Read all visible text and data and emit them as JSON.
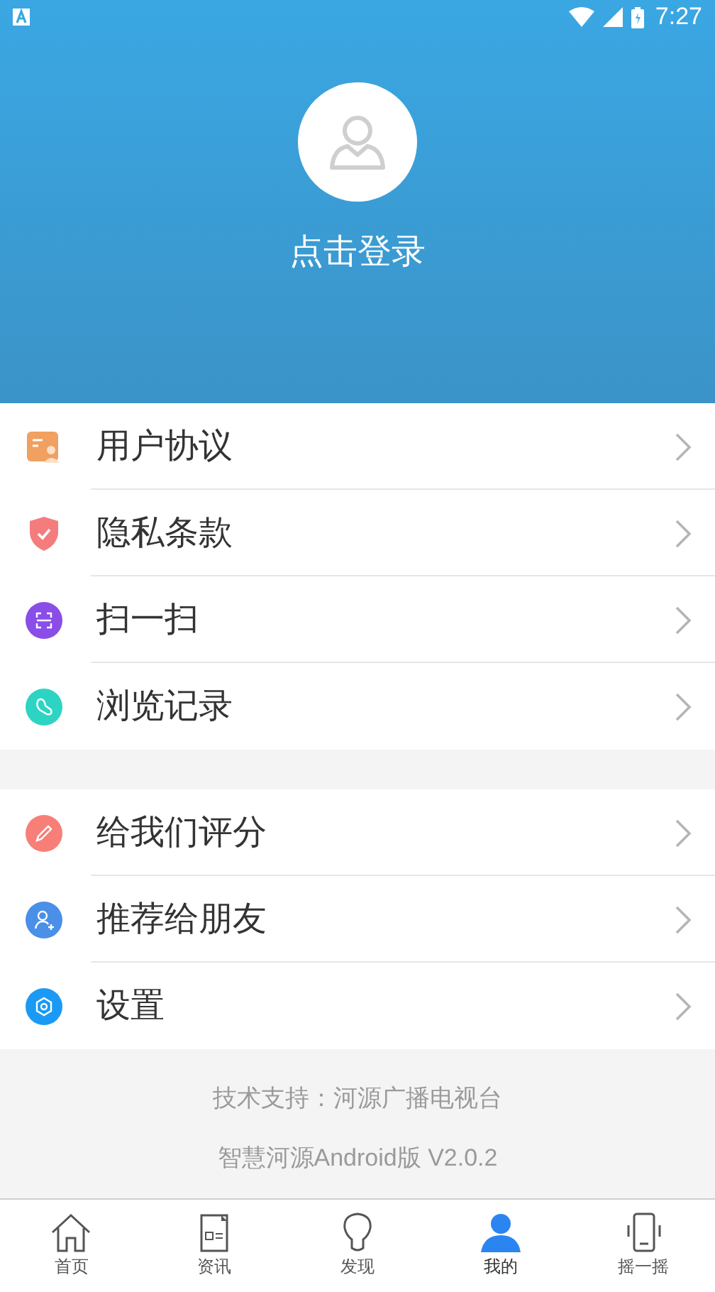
{
  "status_bar": {
    "time": "7:27"
  },
  "profile": {
    "login_label": "点击登录"
  },
  "menu_groups": [
    {
      "items": [
        {
          "label": "用户协议",
          "kind": "card",
          "color": "#f0a060"
        },
        {
          "label": "隐私条款",
          "kind": "shield",
          "color": "#f47c7c"
        },
        {
          "label": "扫一扫",
          "kind": "scan",
          "color": "#8a4de8"
        },
        {
          "label": "浏览记录",
          "kind": "foot",
          "color": "#2dd4c4"
        }
      ]
    },
    {
      "items": [
        {
          "label": "给我们评分",
          "kind": "pencil",
          "color": "#f77f77"
        },
        {
          "label": "推荐给朋友",
          "kind": "person",
          "color": "#4a8fe8"
        },
        {
          "label": "设置",
          "kind": "gear",
          "color": "#1a9af5"
        }
      ]
    }
  ],
  "footer": {
    "support": "技术支持：河源广播电视台",
    "version": "智慧河源Android版 V2.0.2"
  },
  "tab_bar": [
    {
      "label": "首页",
      "kind": "home",
      "selected": false
    },
    {
      "label": "资讯",
      "kind": "news",
      "selected": false
    },
    {
      "label": "发现",
      "kind": "bulb",
      "selected": false
    },
    {
      "label": "我的",
      "kind": "user",
      "selected": true
    },
    {
      "label": "摇一摇",
      "kind": "phone",
      "selected": false
    }
  ]
}
